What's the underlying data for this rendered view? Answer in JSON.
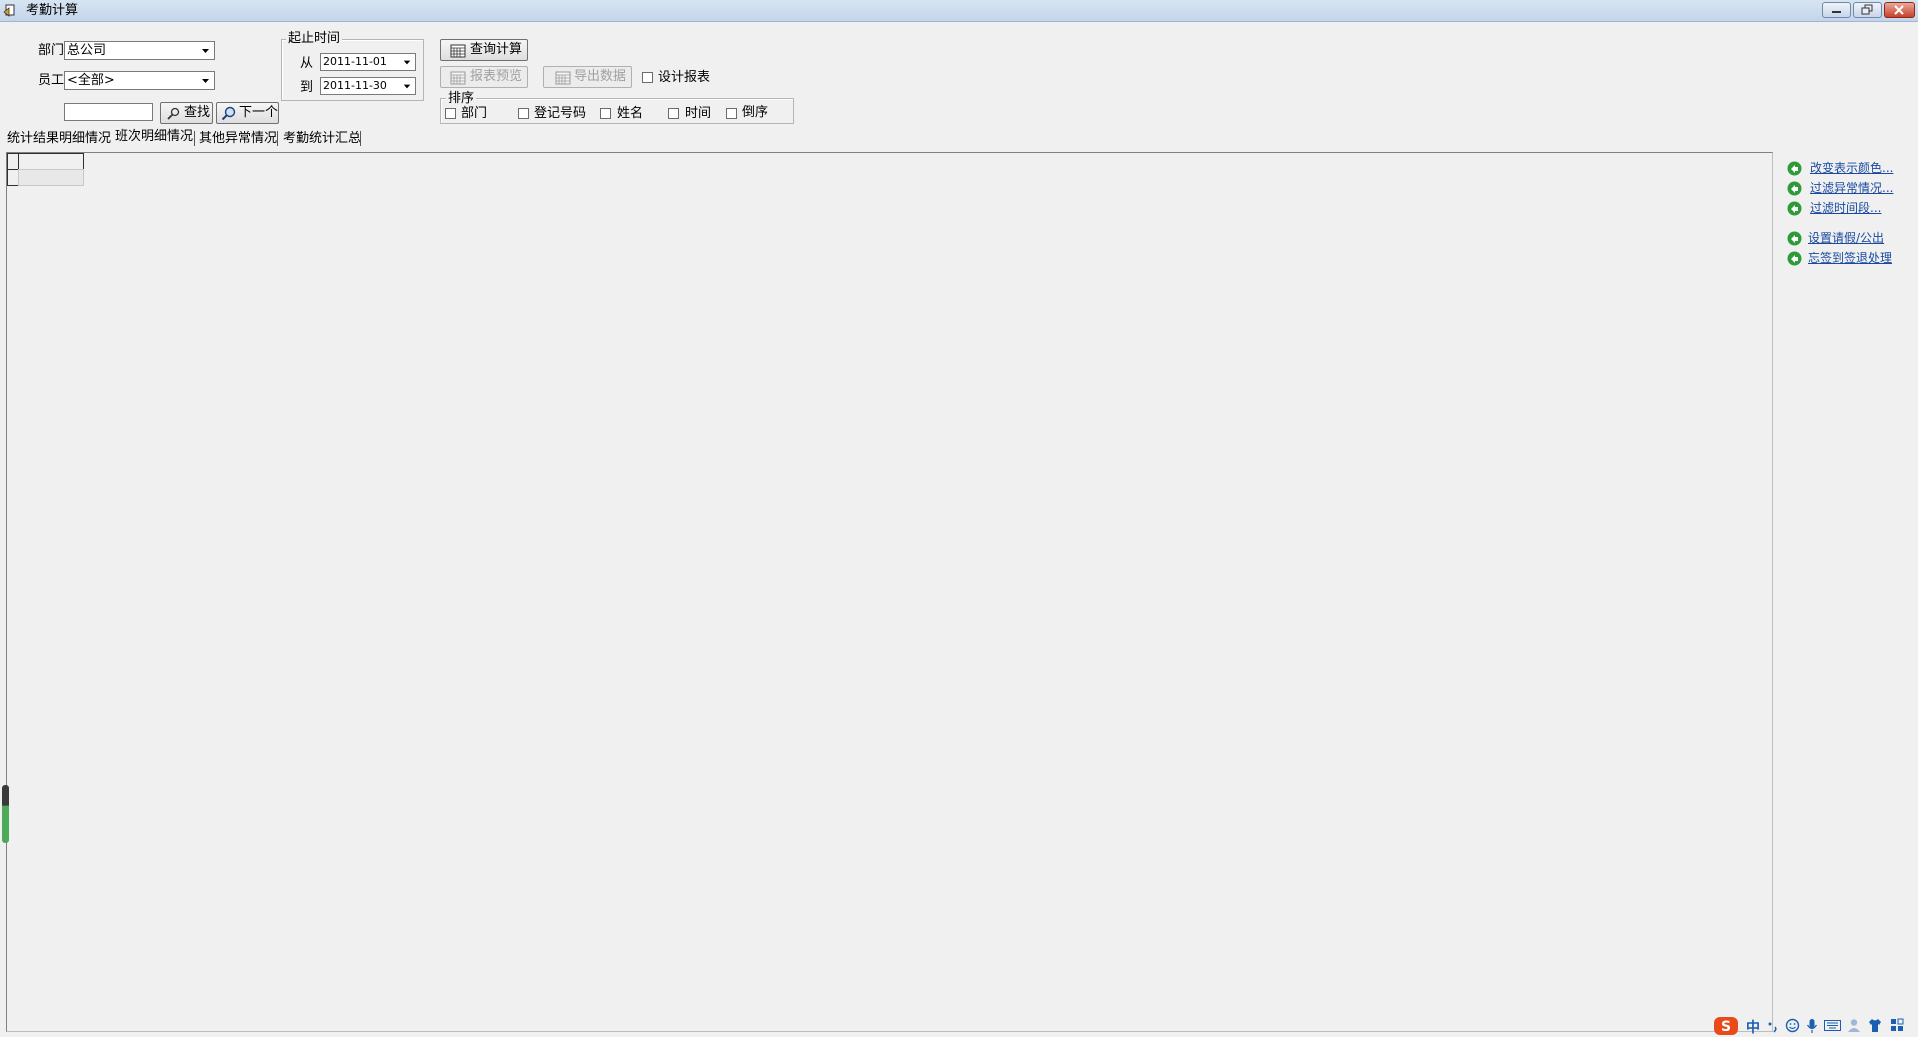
{
  "window": {
    "title": "考勤计算",
    "minimize_icon": "minimize-icon",
    "restore_icon": "restore-icon",
    "close_icon": "close-icon"
  },
  "filters": {
    "department_label": "部门",
    "department_value": "总公司",
    "employee_label": "员工",
    "employee_value": "<全部>",
    "search_input_value": "",
    "find_button": "查找",
    "next_button": "下一个"
  },
  "date_range": {
    "group_label": "起止时间",
    "from_label": "从",
    "from_value": "2011-11-01",
    "to_label": "到",
    "to_value": "2011-11-30"
  },
  "actions": {
    "query_calc": "查询计算",
    "report_preview": "报表预览",
    "export_data": "导出数据",
    "design_report_label": "设计报表",
    "design_report_checked": false
  },
  "sort": {
    "group_label": "排序",
    "options": [
      "部门",
      "登记号码",
      "姓名",
      "时间",
      "倒序"
    ]
  },
  "tabs": [
    "统计结果明细情况",
    "班次明细情况",
    "其他异常情况",
    "考勤统计汇总"
  ],
  "active_tab": 1,
  "side_links": [
    "改变表示颜色...",
    "过滤异常情况...",
    "过滤时间段...",
    "设置请假/公出",
    "忘签到签退处理"
  ],
  "tray": {
    "items": [
      "中"
    ],
    "icons": [
      "sogou-s-icon",
      "punctuation-icon",
      "emoji-icon",
      "mic-icon",
      "keyboard-icon",
      "user-icon",
      "shirt-icon",
      "grid-icon"
    ]
  },
  "colors": {
    "title_bar": "#c4d5ea",
    "link": "#1a4aa0",
    "link_icon": "#2e9b3a",
    "tray_accent": "#e84a1a"
  }
}
